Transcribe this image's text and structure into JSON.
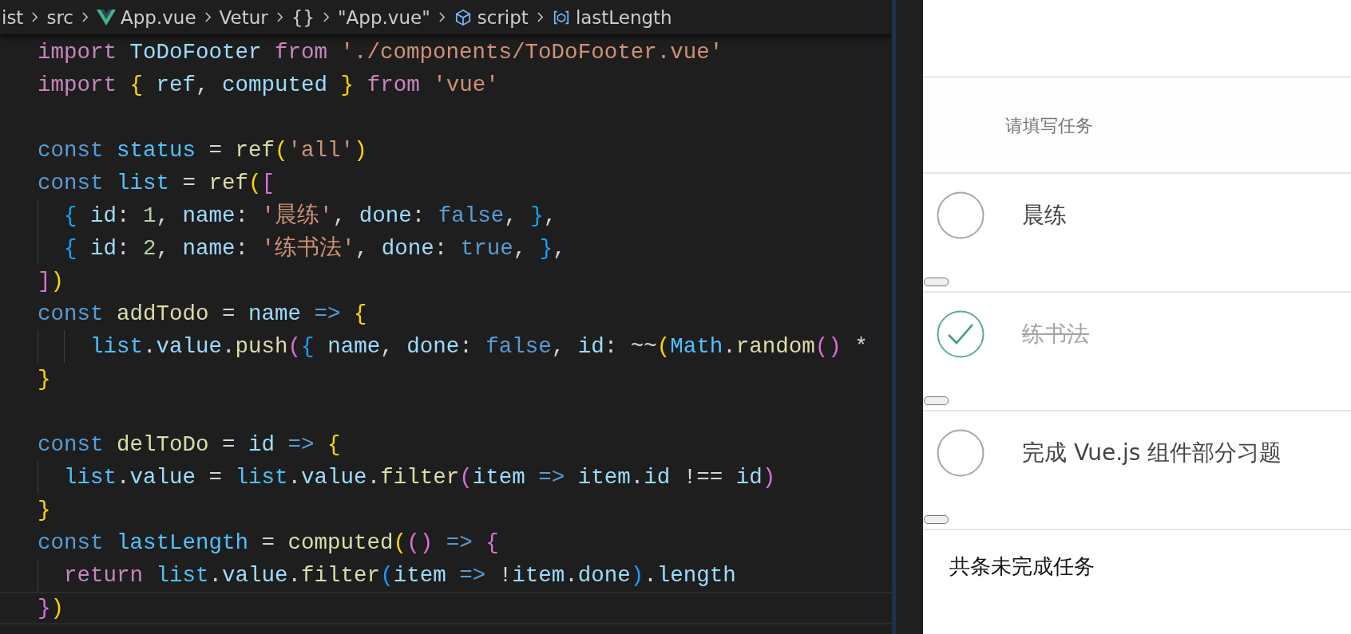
{
  "breadcrumb": [
    {
      "text": "ist",
      "kind": "plain"
    },
    {
      "text": "src",
      "kind": "plain"
    },
    {
      "text": "App.vue",
      "kind": "vue"
    },
    {
      "text": "Vetur",
      "kind": "plain"
    },
    {
      "text": "{}",
      "kind": "plain"
    },
    {
      "text": "\"App.vue\"",
      "kind": "plain"
    },
    {
      "text": "script",
      "kind": "cube"
    },
    {
      "text": "lastLength",
      "kind": "symbol"
    }
  ],
  "code": [
    {
      "tokens": [
        {
          "text": "import ",
          "kind": "ctrl"
        },
        {
          "text": "ToDoFooter ",
          "kind": "var"
        },
        {
          "text": "from ",
          "kind": "ctrl"
        },
        {
          "text": "'./components/ToDoFooter.vue'",
          "kind": "str"
        }
      ]
    },
    {
      "tokens": [
        {
          "text": "import ",
          "kind": "ctrl"
        },
        {
          "text": "{ ",
          "kind": "b1"
        },
        {
          "text": "ref",
          "kind": "var"
        },
        {
          "text": ", ",
          "kind": "plain"
        },
        {
          "text": "computed ",
          "kind": "var"
        },
        {
          "text": "} ",
          "kind": "b1"
        },
        {
          "text": "from ",
          "kind": "ctrl"
        },
        {
          "text": "'vue'",
          "kind": "str"
        }
      ]
    },
    {
      "kind": "blank"
    },
    {
      "tokens": [
        {
          "text": "const ",
          "kind": "kw"
        },
        {
          "text": "status",
          "kind": "const"
        },
        {
          "text": " = ",
          "kind": "plain"
        },
        {
          "text": "ref",
          "kind": "fn"
        },
        {
          "text": "(",
          "kind": "b1"
        },
        {
          "text": "'all'",
          "kind": "str"
        },
        {
          "text": ")",
          "kind": "b1"
        }
      ]
    },
    {
      "tokens": [
        {
          "text": "const ",
          "kind": "kw"
        },
        {
          "text": "list",
          "kind": "const"
        },
        {
          "text": " = ",
          "kind": "plain"
        },
        {
          "text": "ref",
          "kind": "fn"
        },
        {
          "text": "(",
          "kind": "b1"
        },
        {
          "text": "[",
          "kind": "b2"
        }
      ]
    },
    {
      "tokens": [
        {
          "text": "  { ",
          "kind": "b3"
        },
        {
          "text": "id",
          "kind": "var"
        },
        {
          "text": ": ",
          "kind": "plain"
        },
        {
          "text": "1",
          "kind": "num"
        },
        {
          "text": ", ",
          "kind": "plain"
        },
        {
          "text": "name",
          "kind": "var"
        },
        {
          "text": ": ",
          "kind": "plain"
        },
        {
          "text": "'晨练'",
          "kind": "str"
        },
        {
          "text": ", ",
          "kind": "plain"
        },
        {
          "text": "done",
          "kind": "var"
        },
        {
          "text": ": ",
          "kind": "plain"
        },
        {
          "text": "false",
          "kind": "kw"
        },
        {
          "text": ", ",
          "kind": "plain"
        },
        {
          "text": "}",
          "kind": "b3"
        },
        {
          "text": ",",
          "kind": "plain"
        }
      ]
    },
    {
      "tokens": [
        {
          "text": "  { ",
          "kind": "b3"
        },
        {
          "text": "id",
          "kind": "var"
        },
        {
          "text": ": ",
          "kind": "plain"
        },
        {
          "text": "2",
          "kind": "num"
        },
        {
          "text": ", ",
          "kind": "plain"
        },
        {
          "text": "name",
          "kind": "var"
        },
        {
          "text": ": ",
          "kind": "plain"
        },
        {
          "text": "'练书法'",
          "kind": "str"
        },
        {
          "text": ", ",
          "kind": "plain"
        },
        {
          "text": "done",
          "kind": "var"
        },
        {
          "text": ": ",
          "kind": "plain"
        },
        {
          "text": "true",
          "kind": "kw"
        },
        {
          "text": ", ",
          "kind": "plain"
        },
        {
          "text": "}",
          "kind": "b3"
        },
        {
          "text": ",",
          "kind": "plain"
        }
      ]
    },
    {
      "tokens": [
        {
          "text": "]",
          "kind": "b2"
        },
        {
          "text": ")",
          "kind": "b1"
        }
      ]
    },
    {
      "tokens": [
        {
          "text": "const ",
          "kind": "kw"
        },
        {
          "text": "addTodo",
          "kind": "fn"
        },
        {
          "text": " = ",
          "kind": "plain"
        },
        {
          "text": "name ",
          "kind": "var"
        },
        {
          "text": "=> ",
          "kind": "kw"
        },
        {
          "text": "{",
          "kind": "b1"
        }
      ]
    },
    {
      "tokens": [
        {
          "text": "    list",
          "kind": "const"
        },
        {
          "text": ".",
          "kind": "plain"
        },
        {
          "text": "value",
          "kind": "var"
        },
        {
          "text": ".",
          "kind": "plain"
        },
        {
          "text": "push",
          "kind": "fn"
        },
        {
          "text": "(",
          "kind": "b2"
        },
        {
          "text": "{ ",
          "kind": "b3"
        },
        {
          "text": "name",
          "kind": "var"
        },
        {
          "text": ", ",
          "kind": "plain"
        },
        {
          "text": "done",
          "kind": "var"
        },
        {
          "text": ": ",
          "kind": "plain"
        },
        {
          "text": "false",
          "kind": "kw"
        },
        {
          "text": ", ",
          "kind": "plain"
        },
        {
          "text": "id",
          "kind": "var"
        },
        {
          "text": ": ~~",
          "kind": "plain"
        },
        {
          "text": "(",
          "kind": "b1"
        },
        {
          "text": "Math",
          "kind": "const"
        },
        {
          "text": ".",
          "kind": "plain"
        },
        {
          "text": "random",
          "kind": "fn"
        },
        {
          "text": "() ",
          "kind": "b2"
        },
        {
          "text": "*",
          "kind": "plain"
        }
      ]
    },
    {
      "tokens": [
        {
          "text": "}",
          "kind": "b1"
        }
      ]
    },
    {
      "kind": "blank"
    },
    {
      "tokens": [
        {
          "text": "const ",
          "kind": "kw"
        },
        {
          "text": "delToDo",
          "kind": "fn"
        },
        {
          "text": " = ",
          "kind": "plain"
        },
        {
          "text": "id ",
          "kind": "var"
        },
        {
          "text": "=> ",
          "kind": "kw"
        },
        {
          "text": "{",
          "kind": "b1"
        }
      ]
    },
    {
      "tokens": [
        {
          "text": "  list",
          "kind": "const"
        },
        {
          "text": ".",
          "kind": "plain"
        },
        {
          "text": "value",
          "kind": "var"
        },
        {
          "text": " = ",
          "kind": "plain"
        },
        {
          "text": "list",
          "kind": "const"
        },
        {
          "text": ".",
          "kind": "plain"
        },
        {
          "text": "value",
          "kind": "var"
        },
        {
          "text": ".",
          "kind": "plain"
        },
        {
          "text": "filter",
          "kind": "fn"
        },
        {
          "text": "(",
          "kind": "b2"
        },
        {
          "text": "item ",
          "kind": "var"
        },
        {
          "text": "=> ",
          "kind": "kw"
        },
        {
          "text": "item",
          "kind": "var"
        },
        {
          "text": ".",
          "kind": "plain"
        },
        {
          "text": "id",
          "kind": "var"
        },
        {
          "text": " !== ",
          "kind": "plain"
        },
        {
          "text": "id",
          "kind": "var"
        },
        {
          "text": ")",
          "kind": "b2"
        }
      ]
    },
    {
      "tokens": [
        {
          "text": "}",
          "kind": "b1"
        }
      ]
    },
    {
      "tokens": [
        {
          "text": "const ",
          "kind": "kw"
        },
        {
          "text": "lastLength",
          "kind": "const"
        },
        {
          "text": " = ",
          "kind": "plain"
        },
        {
          "text": "computed",
          "kind": "fn"
        },
        {
          "text": "(",
          "kind": "b1"
        },
        {
          "text": "() ",
          "kind": "b2"
        },
        {
          "text": "=> ",
          "kind": "kw"
        },
        {
          "text": "{",
          "kind": "b2"
        }
      ]
    },
    {
      "tokens": [
        {
          "text": "  return ",
          "kind": "ctrl"
        },
        {
          "text": "list",
          "kind": "const"
        },
        {
          "text": ".",
          "kind": "plain"
        },
        {
          "text": "value",
          "kind": "var"
        },
        {
          "text": ".",
          "kind": "plain"
        },
        {
          "text": "filter",
          "kind": "fn"
        },
        {
          "text": "(",
          "kind": "b3"
        },
        {
          "text": "item ",
          "kind": "var"
        },
        {
          "text": "=> ",
          "kind": "kw"
        },
        {
          "text": "!",
          "kind": "plain"
        },
        {
          "text": "item",
          "kind": "var"
        },
        {
          "text": ".",
          "kind": "plain"
        },
        {
          "text": "done",
          "kind": "var"
        },
        {
          "text": ")",
          "kind": "b3"
        },
        {
          "text": ".",
          "kind": "plain"
        },
        {
          "text": "length",
          "kind": "var"
        }
      ]
    },
    {
      "tokens": [
        {
          "text": "}",
          "kind": "b2"
        },
        {
          "text": ")",
          "kind": "b1"
        }
      ],
      "current": true
    }
  ],
  "preview": {
    "input": {
      "placeholder": "请填写任务"
    },
    "items": [
      {
        "name": "晨练",
        "done": false
      },
      {
        "name": "练书法",
        "done": true
      },
      {
        "name": "完成 Vue.js 组件部分习题",
        "done": false
      }
    ],
    "footer": "共条未完成任务"
  }
}
